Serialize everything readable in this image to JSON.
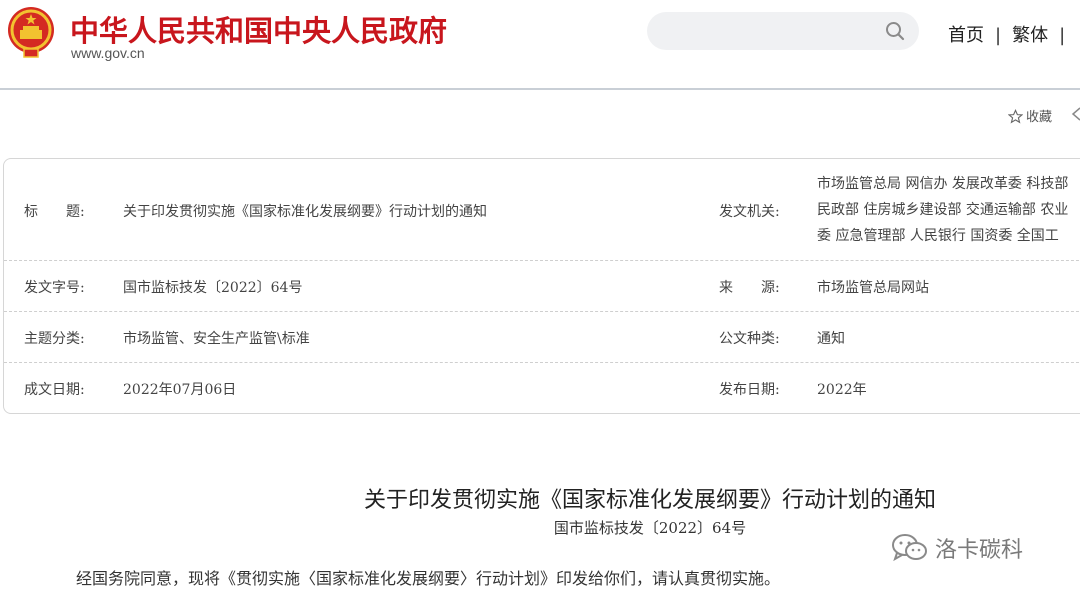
{
  "header": {
    "site_title": "中华人民共和国中央人民政府",
    "site_url": "www.gov.cn",
    "search_placeholder": "",
    "nav": [
      "首页",
      "繁体",
      "|"
    ],
    "favorite_label": "收藏",
    "brand_red": "#c8161d"
  },
  "meta": {
    "title_label": "标　　题:",
    "title_value": "关于印发贯彻实施《国家标准化发展纲要》行动计划的通知",
    "issuer_label": "发文机关:",
    "issuer_lines": [
      "市场监管总局  网信办  发展改革委  科技部",
      "民政部  住房城乡建设部  交通运输部  农业",
      "委  应急管理部  人民银行  国资委  全国工"
    ],
    "docno_label": "发文字号:",
    "docno_value": "国市监标技发〔2022〕64号",
    "source_label": "来　　源:",
    "source_value": "市场监管总局网站",
    "topic_label": "主题分类:",
    "topic_value": "市场监管、安全生产监管\\标准",
    "type_label": "公文种类:",
    "type_value": "通知",
    "written_label": "成文日期:",
    "written_value": "2022年07月06日",
    "published_label": "发布日期:",
    "published_value": "2022年"
  },
  "document": {
    "title": "关于印发贯彻实施《国家标准化发展纲要》行动计划的通知",
    "doc_number": "国市监标技发〔2022〕64号",
    "paragraph": "经国务院同意，现将《贯彻实施〈国家标准化发展纲要〉行动计划》印发给你们，请认真贯彻实施。"
  },
  "watermark": "洛卡碳科",
  "icons": [
    "national-emblem-icon",
    "search-icon",
    "star-icon",
    "share-icon",
    "wechat-icon"
  ]
}
